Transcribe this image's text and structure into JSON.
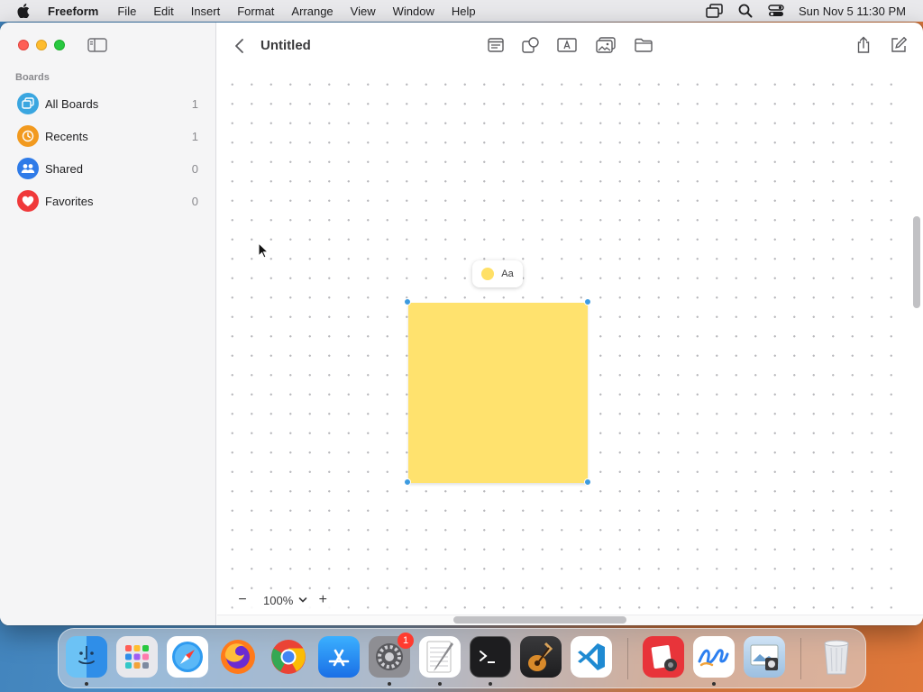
{
  "menubar": {
    "app_name": "Freeform",
    "items": [
      "File",
      "Edit",
      "Insert",
      "Format",
      "Arrange",
      "View",
      "Window",
      "Help"
    ],
    "clock": "Sun Nov 5  11:30 PM"
  },
  "sidebar": {
    "heading": "Boards",
    "items": [
      {
        "label": "All Boards",
        "count": "1",
        "color": "#3aa6e0"
      },
      {
        "label": "Recents",
        "count": "1",
        "color": "#f29a1f"
      },
      {
        "label": "Shared",
        "count": "0",
        "color": "#2f7be8"
      },
      {
        "label": "Favorites",
        "count": "0",
        "color": "#f0393a"
      }
    ]
  },
  "document": {
    "title": "Untitled"
  },
  "canvas": {
    "note_font_label": "Aa",
    "note_color": "#ffe26e",
    "selection_color": "#3d9be0"
  },
  "zoom": {
    "minus": "−",
    "value": "100%",
    "plus": "+"
  },
  "dock": {
    "settings_badge": "1"
  }
}
